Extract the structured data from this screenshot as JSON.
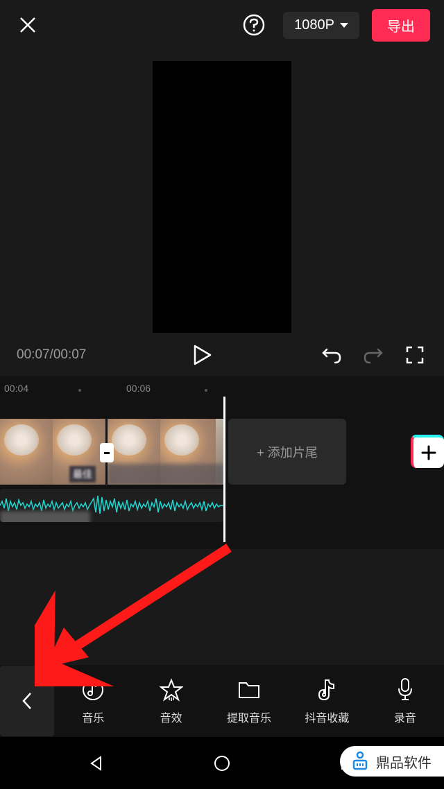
{
  "header": {
    "resolution": "1080P",
    "export_label": "导出"
  },
  "playback": {
    "time_display": "00:07/00:07"
  },
  "ruler": {
    "labels": [
      "00:04",
      "00:06"
    ]
  },
  "timeline": {
    "add_ending_label": "+ 添加片尾",
    "clip_badge": "最佳"
  },
  "toolbar": {
    "items": [
      {
        "label": "音乐",
        "icon": "music"
      },
      {
        "label": "音效",
        "icon": "star"
      },
      {
        "label": "提取音乐",
        "icon": "folder"
      },
      {
        "label": "抖音收藏",
        "icon": "douyin"
      },
      {
        "label": "录音",
        "icon": "mic"
      }
    ]
  },
  "watermark": {
    "text": "鼎品软件"
  }
}
